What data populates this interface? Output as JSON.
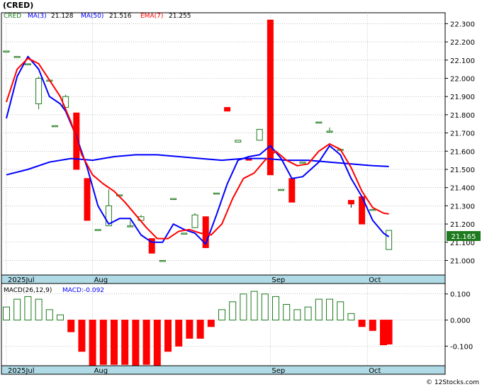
{
  "header": {
    "symbol": "(CRED)",
    "ticker": "CRED",
    "ma3_label": "MA(3)",
    "ma3_value": "21.128",
    "ma50_label": "MA(50)",
    "ma50_value": "21.516",
    "ema7_label": "EMA(7)",
    "ema7_value": "21.255"
  },
  "last_price_label": "21.165",
  "watermark": "© 12Stocks.com",
  "colors": {
    "up_candle": "#1e7a1e",
    "down_candle": "#ff0000",
    "ma_fast": "#0000ff",
    "ma_slow": "#ff0000",
    "axis_band": "#b0dbe6",
    "grid": "#9a9a9a",
    "macd_pos": "#1e7a1e",
    "macd_neg": "#ff0000"
  },
  "chart_data": [
    {
      "type": "candlestick",
      "name": "price",
      "ylim": [
        20.92,
        22.36
      ],
      "yticks": [
        "22.300",
        "22.200",
        "22.100",
        "22.000",
        "21.900",
        "21.800",
        "21.700",
        "21.600",
        "21.500",
        "21.400",
        "21.300",
        "21.200",
        "21.100",
        "21.000"
      ],
      "ytick_values": [
        22.3,
        22.2,
        22.1,
        22.0,
        21.9,
        21.8,
        21.7,
        21.6,
        21.5,
        21.4,
        21.3,
        21.2,
        21.1,
        21.0
      ],
      "x_month_labels": [
        {
          "label": "2025Jul",
          "index": 0
        },
        {
          "label": "Aug",
          "index": 16
        },
        {
          "label": "Sep",
          "index": 49
        },
        {
          "label": "Oct",
          "index": 67
        }
      ],
      "candles": [
        {
          "i": 0,
          "o": 22.15,
          "h": 22.15,
          "l": 22.15,
          "c": 22.15
        },
        {
          "i": 2,
          "o": 22.12,
          "h": 22.12,
          "l": 22.12,
          "c": 22.12
        },
        {
          "i": 4,
          "o": 22.08,
          "h": 22.08,
          "l": 22.08,
          "c": 22.08
        },
        {
          "i": 6,
          "o": 21.86,
          "h": 22.01,
          "l": 21.83,
          "c": 22.0
        },
        {
          "i": 8,
          "o": 21.99,
          "h": 21.99,
          "l": 21.99,
          "c": 21.99
        },
        {
          "i": 9,
          "o": 21.74,
          "h": 21.74,
          "l": 21.74,
          "c": 21.74
        },
        {
          "i": 11,
          "o": 21.84,
          "h": 21.91,
          "l": 21.84,
          "c": 21.9
        },
        {
          "i": 13,
          "o": 21.81,
          "h": 21.81,
          "l": 21.5,
          "c": 21.5
        },
        {
          "i": 15,
          "o": 21.45,
          "h": 21.45,
          "l": 21.22,
          "c": 21.22
        },
        {
          "i": 17,
          "o": 21.17,
          "h": 21.17,
          "l": 21.17,
          "c": 21.17
        },
        {
          "i": 19,
          "o": 21.19,
          "h": 21.39,
          "l": 21.19,
          "c": 21.3
        },
        {
          "i": 21,
          "o": 21.36,
          "h": 21.36,
          "l": 21.36,
          "c": 21.36
        },
        {
          "i": 23,
          "o": 21.19,
          "h": 21.22,
          "l": 21.19,
          "c": 21.19
        },
        {
          "i": 25,
          "o": 21.22,
          "h": 21.25,
          "l": 21.22,
          "c": 21.24
        },
        {
          "i": 27,
          "o": 21.12,
          "h": 21.12,
          "l": 21.04,
          "c": 21.04
        },
        {
          "i": 29,
          "o": 21.0,
          "h": 21.0,
          "l": 21.0,
          "c": 21.0
        },
        {
          "i": 31,
          "o": 21.34,
          "h": 21.34,
          "l": 21.34,
          "c": 21.34
        },
        {
          "i": 33,
          "o": 21.15,
          "h": 21.15,
          "l": 21.15,
          "c": 21.15
        },
        {
          "i": 35,
          "o": 21.18,
          "h": 21.26,
          "l": 21.18,
          "c": 21.25
        },
        {
          "i": 37,
          "o": 21.24,
          "h": 21.24,
          "l": 21.07,
          "c": 21.07
        },
        {
          "i": 39,
          "o": 21.37,
          "h": 21.37,
          "l": 21.37,
          "c": 21.37
        },
        {
          "i": 41,
          "o": 21.84,
          "h": 21.84,
          "l": 21.82,
          "c": 21.82
        },
        {
          "i": 43,
          "o": 21.65,
          "h": 21.66,
          "l": 21.65,
          "c": 21.66
        },
        {
          "i": 45,
          "o": 21.56,
          "h": 21.56,
          "l": 21.55,
          "c": 21.55
        },
        {
          "i": 47,
          "o": 21.66,
          "h": 21.72,
          "l": 21.66,
          "c": 21.72
        },
        {
          "i": 49,
          "o": 22.32,
          "h": 22.32,
          "l": 21.47,
          "c": 21.47
        },
        {
          "i": 51,
          "o": 21.39,
          "h": 21.39,
          "l": 21.39,
          "c": 21.39
        },
        {
          "i": 53,
          "o": 21.45,
          "h": 21.45,
          "l": 21.32,
          "c": 21.32
        },
        {
          "i": 55,
          "o": 21.54,
          "h": 21.54,
          "l": 21.54,
          "c": 21.54
        },
        {
          "i": 58,
          "o": 21.76,
          "h": 21.76,
          "l": 21.76,
          "c": 21.76
        },
        {
          "i": 60,
          "o": 21.71,
          "h": 21.73,
          "l": 21.71,
          "c": 21.71
        },
        {
          "i": 62,
          "o": 21.61,
          "h": 21.61,
          "l": 21.61,
          "c": 21.61
        },
        {
          "i": 64,
          "o": 21.33,
          "h": 21.33,
          "l": 21.29,
          "c": 21.31
        },
        {
          "i": 66,
          "o": 21.35,
          "h": 21.35,
          "l": 21.2,
          "c": 21.2
        },
        {
          "i": 68,
          "o": 21.28,
          "h": 21.28,
          "l": 21.28,
          "c": 21.28
        },
        {
          "i": 71,
          "o": 21.06,
          "h": 21.16,
          "l": 21.06,
          "c": 21.165
        }
      ],
      "series": [
        {
          "name": "MA(3)",
          "values": [
            [
              0,
              21.78
            ],
            [
              2,
              22.01
            ],
            [
              4,
              22.12
            ],
            [
              6,
              22.05
            ],
            [
              8,
              21.9
            ],
            [
              10,
              21.86
            ],
            [
              11,
              21.82
            ],
            [
              13,
              21.68
            ],
            [
              15,
              21.51
            ],
            [
              17,
              21.3
            ],
            [
              19,
              21.2
            ],
            [
              21,
              21.23
            ],
            [
              23,
              21.23
            ],
            [
              25,
              21.14
            ],
            [
              27,
              21.1
            ],
            [
              29,
              21.1
            ],
            [
              31,
              21.2
            ],
            [
              33,
              21.17
            ],
            [
              35,
              21.15
            ],
            [
              37,
              21.09
            ],
            [
              39,
              21.25
            ],
            [
              41,
              21.42
            ],
            [
              43,
              21.55
            ],
            [
              45,
              21.57
            ],
            [
              47,
              21.58
            ],
            [
              49,
              21.63
            ],
            [
              51,
              21.56
            ],
            [
              53,
              21.45
            ],
            [
              55,
              21.46
            ],
            [
              58,
              21.54
            ],
            [
              60,
              21.63
            ],
            [
              62,
              21.58
            ],
            [
              64,
              21.45
            ],
            [
              66,
              21.35
            ],
            [
              68,
              21.22
            ],
            [
              70,
              21.15
            ],
            [
              71,
              21.13
            ]
          ]
        },
        {
          "name": "MA(50)",
          "values": [
            [
              0,
              21.47
            ],
            [
              4,
              21.5
            ],
            [
              8,
              21.54
            ],
            [
              12,
              21.56
            ],
            [
              16,
              21.55
            ],
            [
              20,
              21.57
            ],
            [
              24,
              21.58
            ],
            [
              28,
              21.58
            ],
            [
              32,
              21.57
            ],
            [
              36,
              21.56
            ],
            [
              40,
              21.55
            ],
            [
              44,
              21.56
            ],
            [
              48,
              21.56
            ],
            [
              52,
              21.55
            ],
            [
              56,
              21.55
            ],
            [
              60,
              21.54
            ],
            [
              64,
              21.53
            ],
            [
              68,
              21.52
            ],
            [
              71,
              21.516
            ]
          ]
        },
        {
          "name": "EMA(7)",
          "values": [
            [
              0,
              21.87
            ],
            [
              2,
              22.05
            ],
            [
              4,
              22.11
            ],
            [
              6,
              22.08
            ],
            [
              8,
              21.99
            ],
            [
              10,
              21.9
            ],
            [
              12,
              21.76
            ],
            [
              14,
              21.58
            ],
            [
              16,
              21.47
            ],
            [
              18,
              21.42
            ],
            [
              20,
              21.38
            ],
            [
              22,
              21.32
            ],
            [
              24,
              21.25
            ],
            [
              26,
              21.18
            ],
            [
              28,
              21.12
            ],
            [
              30,
              21.12
            ],
            [
              32,
              21.16
            ],
            [
              34,
              21.17
            ],
            [
              36,
              21.15
            ],
            [
              38,
              21.14
            ],
            [
              40,
              21.2
            ],
            [
              42,
              21.34
            ],
            [
              44,
              21.45
            ],
            [
              46,
              21.48
            ],
            [
              48,
              21.55
            ],
            [
              50,
              21.6
            ],
            [
              52,
              21.55
            ],
            [
              54,
              21.52
            ],
            [
              56,
              21.53
            ],
            [
              58,
              21.6
            ],
            [
              60,
              21.64
            ],
            [
              62,
              21.61
            ],
            [
              64,
              21.51
            ],
            [
              66,
              21.38
            ],
            [
              68,
              21.29
            ],
            [
              70,
              21.26
            ],
            [
              71,
              21.255
            ]
          ]
        }
      ]
    },
    {
      "type": "bar",
      "name": "MACD histogram",
      "title": "MACD(26,12,9)",
      "value_label": "MACD:-0.092",
      "ylim": [
        -0.175,
        0.14
      ],
      "yticks": [
        "0.100",
        "0.000",
        "-0.100"
      ],
      "ytick_values": [
        0.1,
        0.0,
        -0.1
      ],
      "x_month_labels": [
        {
          "label": "2025Jul",
          "index": 0
        },
        {
          "label": "Aug",
          "index": 16
        },
        {
          "label": "Sep",
          "index": 49
        },
        {
          "label": "Oct",
          "index": 67
        }
      ],
      "bars": [
        {
          "i": 0,
          "v": 0.05
        },
        {
          "i": 2,
          "v": 0.08
        },
        {
          "i": 4,
          "v": 0.09
        },
        {
          "i": 6,
          "v": 0.08
        },
        {
          "i": 8,
          "v": 0.04
        },
        {
          "i": 10,
          "v": 0.02
        },
        {
          "i": 12,
          "v": -0.045
        },
        {
          "i": 14,
          "v": -0.12
        },
        {
          "i": 16,
          "v": -0.18
        },
        {
          "i": 18,
          "v": -0.17
        },
        {
          "i": 20,
          "v": -0.17
        },
        {
          "i": 22,
          "v": -0.17
        },
        {
          "i": 24,
          "v": -0.175
        },
        {
          "i": 26,
          "v": -0.17
        },
        {
          "i": 28,
          "v": -0.175
        },
        {
          "i": 30,
          "v": -0.12
        },
        {
          "i": 32,
          "v": -0.1
        },
        {
          "i": 34,
          "v": -0.07
        },
        {
          "i": 36,
          "v": -0.07
        },
        {
          "i": 38,
          "v": -0.025
        },
        {
          "i": 40,
          "v": 0.04
        },
        {
          "i": 42,
          "v": 0.07
        },
        {
          "i": 44,
          "v": 0.1
        },
        {
          "i": 46,
          "v": 0.11
        },
        {
          "i": 48,
          "v": 0.1
        },
        {
          "i": 50,
          "v": 0.09
        },
        {
          "i": 52,
          "v": 0.06
        },
        {
          "i": 54,
          "v": 0.04
        },
        {
          "i": 56,
          "v": 0.05
        },
        {
          "i": 58,
          "v": 0.08
        },
        {
          "i": 60,
          "v": 0.08
        },
        {
          "i": 62,
          "v": 0.07
        },
        {
          "i": 64,
          "v": 0.025
        },
        {
          "i": 66,
          "v": -0.025
        },
        {
          "i": 68,
          "v": -0.04
        },
        {
          "i": 70,
          "v": -0.095
        },
        {
          "i": 71,
          "v": -0.092
        }
      ]
    }
  ]
}
